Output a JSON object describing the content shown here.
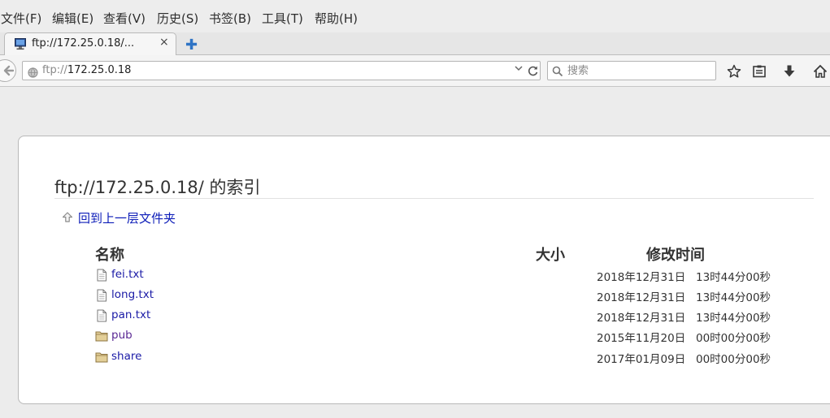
{
  "menubar": {
    "items": [
      "文件(F)",
      "编辑(E)",
      "查看(V)",
      "历史(S)",
      "书签(B)",
      "工具(T)",
      "帮助(H)"
    ]
  },
  "tab": {
    "title": "ftp://172.25.0.18/...",
    "close": "×",
    "new_tab": "✚"
  },
  "navbar": {
    "url_protocol": "ftp://",
    "url_host": "172.25.0.18",
    "search_placeholder": "搜索",
    "icons": [
      "back-icon",
      "globe-icon",
      "dropdown-icon",
      "reload-icon",
      "search-icon",
      "bookmark-star-icon",
      "reader-icon",
      "download-icon",
      "home-icon"
    ]
  },
  "page": {
    "title": "ftp://172.25.0.18/ 的索引",
    "up_link": "回到上一层文件夹",
    "columns": {
      "name": "名称",
      "size": "大小",
      "modified": "修改时间"
    },
    "entries": [
      {
        "name": "fei.txt",
        "type": "file",
        "size": "",
        "date": "2018年12月31日",
        "time": "13时44分00秒"
      },
      {
        "name": "long.txt",
        "type": "file",
        "size": "",
        "date": "2018年12月31日",
        "time": "13时44分00秒"
      },
      {
        "name": "pan.txt",
        "type": "file",
        "size": "",
        "date": "2018年12月31日",
        "time": "13时44分00秒"
      },
      {
        "name": "pub",
        "type": "folder",
        "size": "",
        "date": "2015年11月20日",
        "time": "00时00分00秒"
      },
      {
        "name": "share",
        "type": "folder",
        "size": "",
        "date": "2017年01月09日",
        "time": "00时00分00秒"
      }
    ]
  }
}
